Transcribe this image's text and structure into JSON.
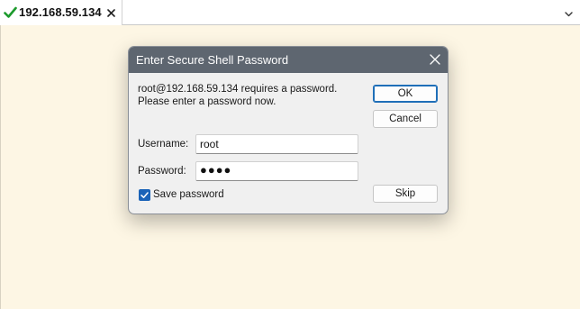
{
  "tab": {
    "label": "192.168.59.134",
    "status_icon": "check-icon",
    "status_color": "#1c9a2c"
  },
  "terminal": {
    "background": "#fdf6e4"
  },
  "dialog": {
    "title": "Enter Secure Shell Password",
    "message_line1": "root@192.168.59.134 requires a password.",
    "message_line2": "Please enter a password now.",
    "username_label": "Username:",
    "username_value": "root",
    "password_label": "Password:",
    "password_value": "●●●●",
    "save_password_label": "Save password",
    "save_password_checked": true,
    "ok_label": "OK",
    "cancel_label": "Cancel",
    "skip_label": "Skip",
    "titlebar_color": "#5e6670",
    "accent_color": "#1a63b8"
  }
}
